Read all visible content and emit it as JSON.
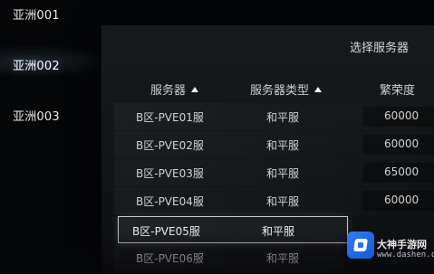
{
  "regions": [
    {
      "label": "亚洲001",
      "active": false
    },
    {
      "label": "亚洲002",
      "active": true
    },
    {
      "label": "亚洲003",
      "active": false
    }
  ],
  "panel": {
    "title": "选择服务器",
    "headers": {
      "name": "服务器",
      "type": "服务器类型",
      "load": "繁荣度"
    }
  },
  "servers": [
    {
      "name": "B区-PVE01服",
      "type": "和平服",
      "load": "60000",
      "selected": false
    },
    {
      "name": "B区-PVE02服",
      "type": "和平服",
      "load": "60000",
      "selected": false
    },
    {
      "name": "B区-PVE03服",
      "type": "和平服",
      "load": "65000",
      "selected": false
    },
    {
      "name": "B区-PVE04服",
      "type": "和平服",
      "load": "60000",
      "selected": false
    },
    {
      "name": "B区-PVE05服",
      "type": "和平服",
      "load": "",
      "selected": true
    },
    {
      "name": "B区-PVE06服",
      "type": "和平服",
      "load": "",
      "selected": false
    }
  ],
  "watermark": {
    "name": "大神手游网",
    "url": "www.dashen.com"
  }
}
